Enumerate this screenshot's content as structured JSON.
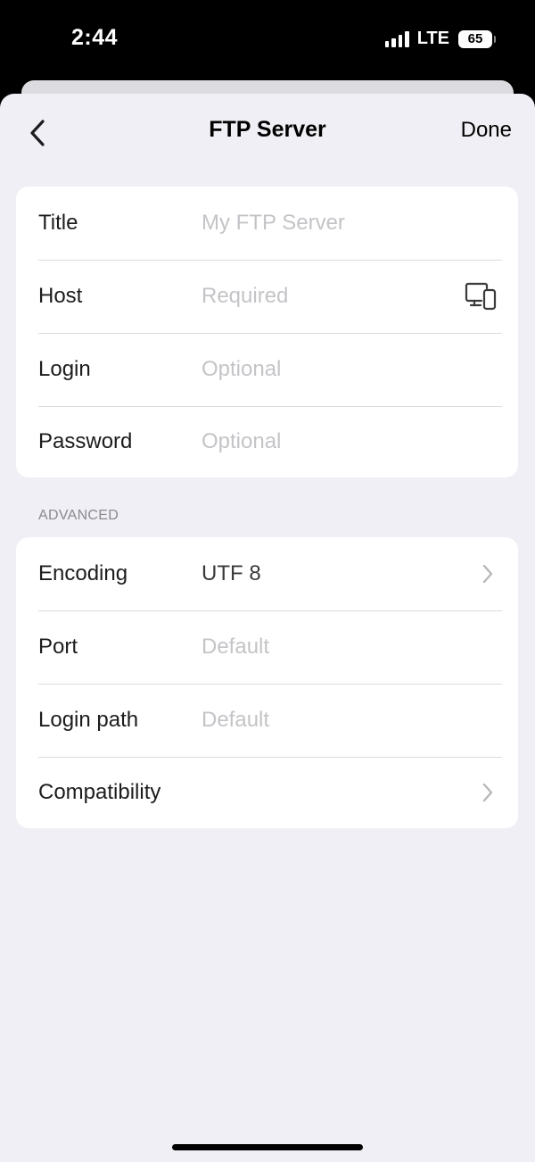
{
  "status_bar": {
    "time": "2:44",
    "network": "LTE",
    "battery": "65"
  },
  "nav": {
    "title": "FTP Server",
    "done_label": "Done",
    "back_icon": "chevron-left-icon"
  },
  "form": {
    "rows": [
      {
        "label": "Title",
        "placeholder": "My FTP Server",
        "value": ""
      },
      {
        "label": "Host",
        "placeholder": "Required",
        "value": "",
        "icon": "local-devices-icon"
      },
      {
        "label": "Login",
        "placeholder": "Optional",
        "value": ""
      },
      {
        "label": "Password",
        "placeholder": "Optional",
        "value": ""
      }
    ]
  },
  "advanced": {
    "header": "ADVANCED",
    "encoding": {
      "label": "Encoding",
      "value": "UTF 8"
    },
    "port": {
      "label": "Port",
      "placeholder": "Default",
      "value": ""
    },
    "login_path": {
      "label": "Login path",
      "placeholder": "Default",
      "value": ""
    },
    "compatibility": {
      "label": "Compatibility"
    }
  },
  "colors": {
    "background": "#f0eff5",
    "card": "#ffffff",
    "placeholder": "#c4c4c8",
    "section_header": "#8a8a8e"
  }
}
